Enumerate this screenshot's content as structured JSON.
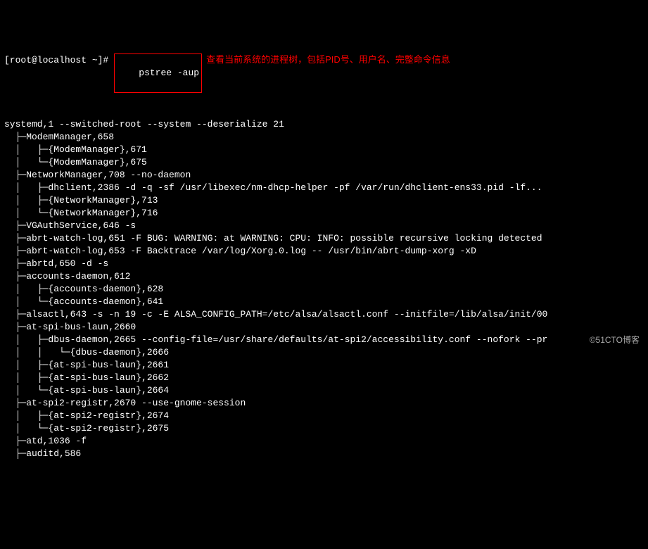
{
  "prompt": {
    "user_host": "[root@localhost ~]#",
    "command": "pstree -aup",
    "annotation": "查看当前系统的进程树，包括PID号、用户名、完整命令信息"
  },
  "lines": [
    "systemd,1 --switched-root --system --deserialize 21",
    "  ├─ModemManager,658",
    "  │   ├─{ModemManager},671",
    "  │   └─{ModemManager},675",
    "  ├─NetworkManager,708 --no-daemon",
    "  │   ├─dhclient,2386 -d -q -sf /usr/libexec/nm-dhcp-helper -pf /var/run/dhclient-ens33.pid -lf...",
    "  │   ├─{NetworkManager},713",
    "  │   └─{NetworkManager},716",
    "  ├─VGAuthService,646 -s",
    "  ├─abrt-watch-log,651 -F BUG: WARNING: at WARNING: CPU: INFO: possible recursive locking detected ",
    "  ├─abrt-watch-log,653 -F Backtrace /var/log/Xorg.0.log -- /usr/bin/abrt-dump-xorg -xD",
    "  ├─abrtd,650 -d -s",
    "  ├─accounts-daemon,612",
    "  │   ├─{accounts-daemon},628",
    "  │   └─{accounts-daemon},641",
    "  ├─alsactl,643 -s -n 19 -c -E ALSA_CONFIG_PATH=/etc/alsa/alsactl.conf --initfile=/lib/alsa/init/00",
    "  ├─at-spi-bus-laun,2660",
    "  │   ├─dbus-daemon,2665 --config-file=/usr/share/defaults/at-spi2/accessibility.conf --nofork --pr",
    "  │   │   └─{dbus-daemon},2666",
    "  │   ├─{at-spi-bus-laun},2661",
    "  │   ├─{at-spi-bus-laun},2662",
    "  │   └─{at-spi-bus-laun},2664",
    "  ├─at-spi2-registr,2670 --use-gnome-session",
    "  │   ├─{at-spi2-registr},2674",
    "  │   └─{at-spi2-registr},2675",
    "  ├─atd,1036 -f",
    "  ├─auditd,586"
  ],
  "watermark": "©51CTO博客"
}
